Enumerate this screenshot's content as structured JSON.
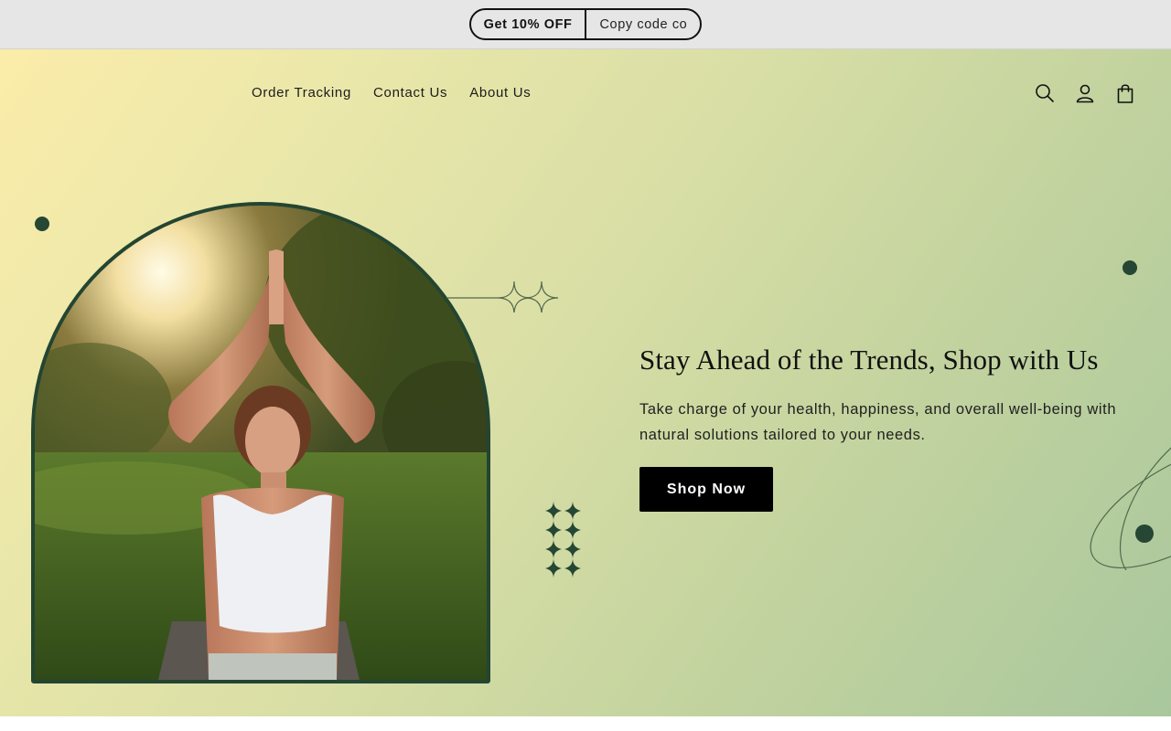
{
  "announcement": {
    "offer_label": "Get 10% OFF",
    "copy_label": "Copy code co"
  },
  "nav": {
    "items": [
      {
        "label": "Order Tracking"
      },
      {
        "label": "Contact Us"
      },
      {
        "label": "About Us"
      }
    ]
  },
  "header_icons": [
    "search-icon",
    "account-icon",
    "cart-icon"
  ],
  "hero": {
    "title": "Stay Ahead of the Trends, Shop with Us",
    "subtitle": "Take charge of your health, happiness, and overall well-being with natural solutions tailored to your needs.",
    "cta_label": "Shop Now"
  },
  "colors": {
    "accent_dark_green": "#234532",
    "button_bg": "#000000",
    "announcement_bg": "#e6e6e6",
    "gradient_start": "#fbeca9",
    "gradient_end": "#a9c79d"
  }
}
